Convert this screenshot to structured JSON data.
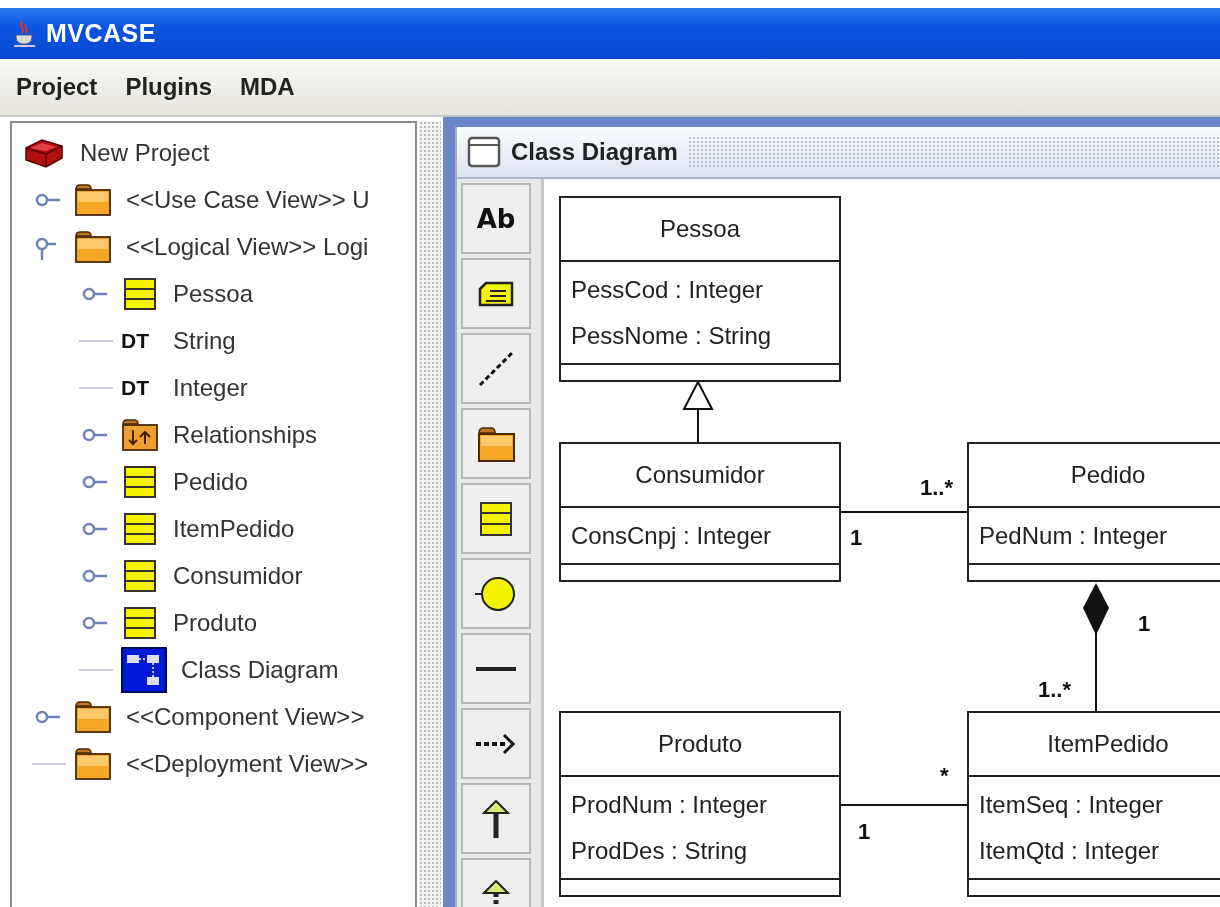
{
  "window": {
    "title": "MVCASE"
  },
  "menu": [
    "Project",
    "Plugins",
    "MDA"
  ],
  "tree": {
    "label": "New Project",
    "kind": "project",
    "children": [
      {
        "label": "<<Use Case View>> U",
        "kind": "package",
        "expanded": false
      },
      {
        "label": "<<Logical View>> Logi",
        "kind": "package",
        "expanded": true,
        "children": [
          {
            "label": "Pessoa",
            "kind": "class",
            "expanded": false
          },
          {
            "label": "String",
            "kind": "datatype",
            "badge": "DT"
          },
          {
            "label": "Integer",
            "kind": "datatype",
            "badge": "DT"
          },
          {
            "label": "Relationships",
            "kind": "relationships",
            "expanded": false
          },
          {
            "label": "Pedido",
            "kind": "class",
            "expanded": false
          },
          {
            "label": "ItemPedido",
            "kind": "class",
            "expanded": false
          },
          {
            "label": "Consumidor",
            "kind": "class",
            "expanded": false
          },
          {
            "label": "Produto",
            "kind": "class",
            "expanded": false
          },
          {
            "label": "Class Diagram",
            "kind": "diagram"
          }
        ]
      },
      {
        "label": "<<Component View>>",
        "kind": "package",
        "expanded": false
      },
      {
        "label": "<<Deployment View>>",
        "kind": "package"
      }
    ]
  },
  "diagram_window": {
    "title": "Class Diagram"
  },
  "tools": [
    {
      "kind": "text",
      "label": "Ab"
    },
    {
      "kind": "note"
    },
    {
      "kind": "dashed-line"
    },
    {
      "kind": "package"
    },
    {
      "kind": "class"
    },
    {
      "kind": "interface"
    },
    {
      "kind": "association"
    },
    {
      "kind": "dependency"
    },
    {
      "kind": "generalization"
    },
    {
      "kind": "realization"
    }
  ],
  "diagram": {
    "classes": [
      {
        "name": "Pessoa",
        "attributes": [
          "PessCod : Integer",
          "PessNome : String"
        ]
      },
      {
        "name": "Consumidor",
        "attributes": [
          "ConsCnpj : Integer"
        ]
      },
      {
        "name": "Pedido",
        "attributes": [
          "PedNum : Integer"
        ]
      },
      {
        "name": "Produto",
        "attributes": [
          "ProdNum : Integer",
          "ProdDes : String"
        ]
      },
      {
        "name": "ItemPedido",
        "attributes": [
          "ItemSeq : Integer",
          "ItemQtd : Integer"
        ]
      }
    ],
    "relations": [
      {
        "kind": "generalization"
      },
      {
        "kind": "association",
        "labels": [
          "1",
          "1..*"
        ]
      },
      {
        "kind": "composition",
        "labels": [
          "1",
          "1..*"
        ]
      },
      {
        "kind": "association",
        "labels": [
          "1",
          "*"
        ]
      }
    ]
  }
}
